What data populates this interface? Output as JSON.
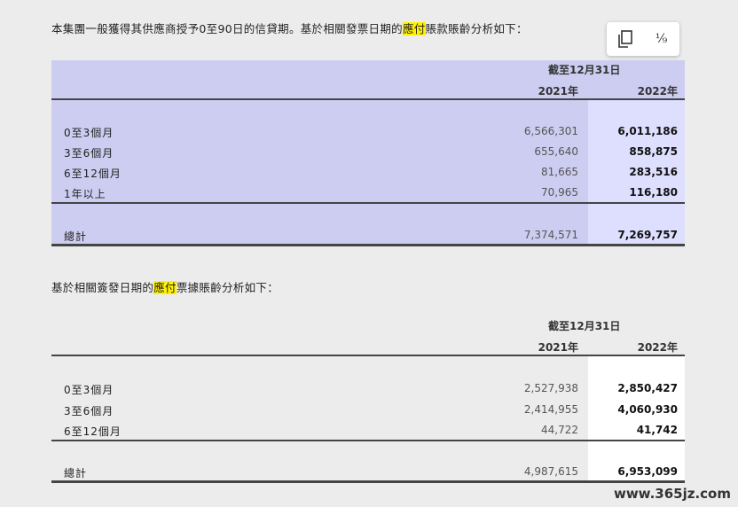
{
  "para1": {
    "before": "本集團一般獲得其供應商授予0至90日的信貸期。基於相關發票日期的",
    "highlight": "應付",
    "after": "賬款賬齡分析如下："
  },
  "toolbar": {
    "copy_icon": "copy-icon",
    "fraction_label": "⅟₉"
  },
  "table1": {
    "period_header": "截至12月31日",
    "col1_header": "2021年",
    "col2_header": "2022年",
    "rows": [
      {
        "label": "0至3個月",
        "v2021": "6,566,301",
        "v2022": "6,011,186"
      },
      {
        "label": "3至6個月",
        "v2021": "655,640",
        "v2022": "858,875"
      },
      {
        "label": "6至12個月",
        "v2021": "81,665",
        "v2022": "283,516"
      },
      {
        "label": "1年以上",
        "v2021": "70,965",
        "v2022": "116,180"
      }
    ],
    "total": {
      "label": "總計",
      "v2021": "7,374,571",
      "v2022": "7,269,757"
    }
  },
  "para2": {
    "before": "基於相關簽發日期的",
    "highlight": "應付",
    "after": "票據賬齡分析如下："
  },
  "table2": {
    "period_header": "截至12月31日",
    "col1_header": "2021年",
    "col2_header": "2022年",
    "rows": [
      {
        "label": "0至3個月",
        "v2021": "2,527,938",
        "v2022": "2,850,427"
      },
      {
        "label": "3至6個月",
        "v2021": "2,414,955",
        "v2022": "4,060,930"
      },
      {
        "label": "6至12個月",
        "v2021": "44,722",
        "v2022": "41,742"
      }
    ],
    "total": {
      "label": "總計",
      "v2021": "4,987,615",
      "v2022": "6,953,099"
    }
  },
  "watermark": "www.365jz.com",
  "colors": {
    "highlight": "#fff200",
    "table1_bg": "#cdcdf2",
    "table1_col_bg": "#dedeff"
  }
}
